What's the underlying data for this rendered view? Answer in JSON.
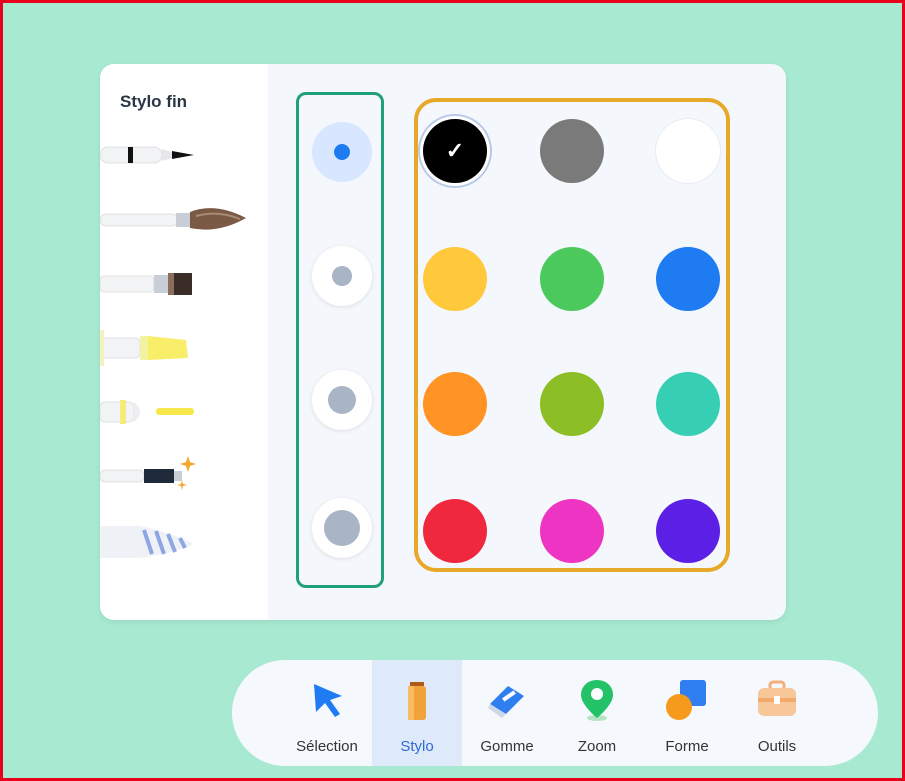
{
  "pen_panel": {
    "title": "Stylo fin",
    "pens": [
      {
        "icon": "fine-pen-icon"
      },
      {
        "icon": "brush-icon"
      },
      {
        "icon": "flat-brush-icon"
      },
      {
        "icon": "highlighter-icon"
      },
      {
        "icon": "fluorescent-marker-icon"
      },
      {
        "icon": "sparkle-pen-icon"
      },
      {
        "icon": "texture-pen-icon"
      }
    ]
  },
  "sizes": {
    "selected_index": 0,
    "options": [
      "size-1",
      "size-2",
      "size-3",
      "size-4"
    ]
  },
  "colors": {
    "selected": "#000000",
    "swatches": [
      "#000000",
      "#7a7a7a",
      "#ffffff",
      "#ffc93b",
      "#4cc95c",
      "#1f7bf2",
      "#ff9324",
      "#8cbf26",
      "#36cfb4",
      "#f0283e",
      "#ee34c2",
      "#5b1fe6"
    ]
  },
  "toolbar": {
    "active": "Stylo",
    "tools": [
      {
        "label": "Sélection",
        "icon": "cursor-arrow-icon"
      },
      {
        "label": "Stylo",
        "icon": "pencil-icon"
      },
      {
        "label": "Gomme",
        "icon": "eraser-icon"
      },
      {
        "label": "Zoom",
        "icon": "location-pin-icon"
      },
      {
        "label": "Forme",
        "icon": "shapes-icon"
      },
      {
        "label": "Outils",
        "icon": "toolbox-icon"
      }
    ]
  },
  "highlight_colors": {
    "sizes_box": "#1fa07c",
    "colors_box": "#e8a82a",
    "frame": "#e8001c"
  }
}
